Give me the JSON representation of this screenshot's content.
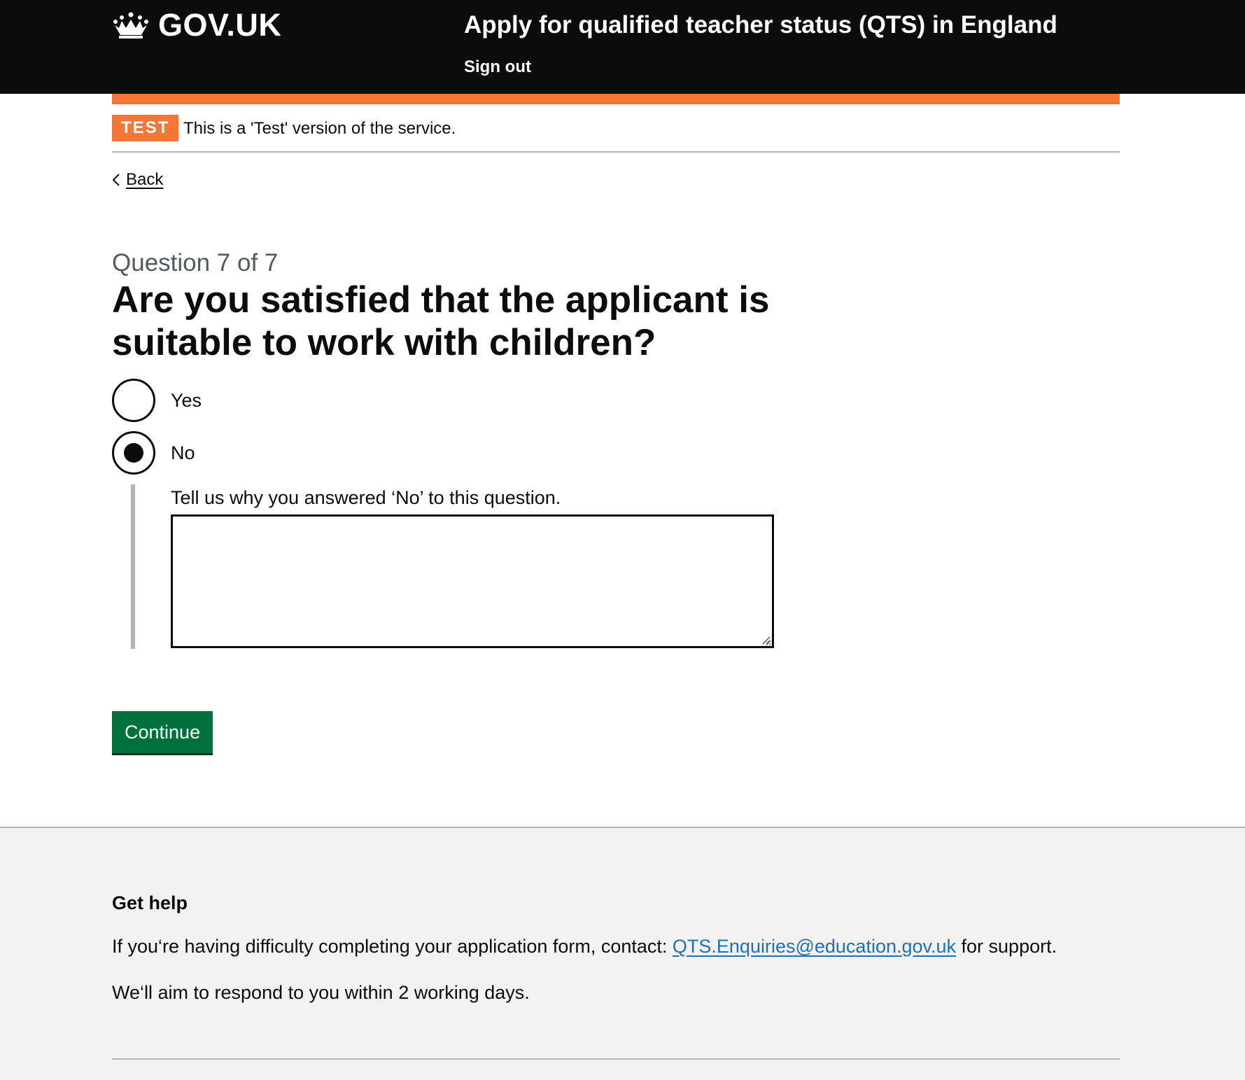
{
  "header": {
    "logo_text": "GOV.UK",
    "service_name": "Apply for qualified teacher status (QTS) in England",
    "sign_out_label": "Sign out"
  },
  "phase_banner": {
    "tag": "TEST",
    "text": "This is a 'Test' version of the service."
  },
  "back_link": {
    "label": "Back"
  },
  "question": {
    "caption": "Question 7 of 7",
    "heading_line1": "Are you satisfied that the applicant is",
    "heading_line2": "suitable to work with children?",
    "options": [
      {
        "label": "Yes",
        "selected": false
      },
      {
        "label": "No",
        "selected": true
      }
    ],
    "conditional_label": "Tell us why you answered ‘No’ to this question.",
    "textarea_value": ""
  },
  "continue_label": "Continue",
  "footer": {
    "heading": "Get help",
    "line1_before": "If you‘re having difficulty completing your application form, contact: ",
    "line1_link": "QTS.Enquiries@education.gov.uk",
    "line1_after": " for support.",
    "line2": "We‘ll aim to respond to you within 2 working days."
  },
  "colors": {
    "header_bg": "#0b0c0c",
    "phase_orange": "#f47738",
    "button_green": "#00703c",
    "link_blue": "#1d70b8",
    "footer_bg": "#f3f2f1",
    "secondary_text": "#505a5f"
  },
  "icons": {
    "logo": "crown-icon",
    "back": "chevron-left-icon",
    "textarea_grip": "resize-grip-icon"
  }
}
